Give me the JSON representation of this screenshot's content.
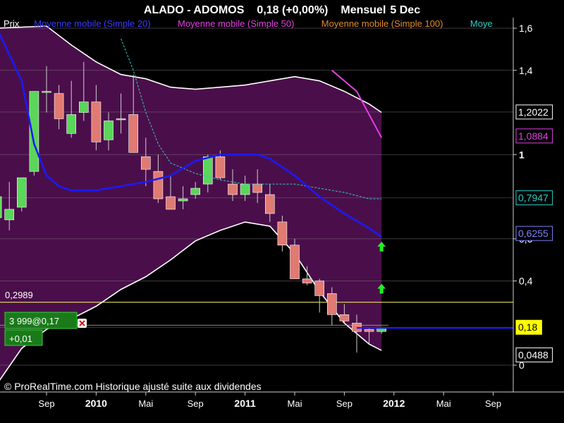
{
  "header": {
    "title": "ALADO - ADOMOS",
    "price_change": "0,18 (+0,00%)",
    "period": "Mensuel",
    "date": "5 Dec"
  },
  "legend": [
    {
      "label": "Prix",
      "color": "#ffffff"
    },
    {
      "label": "Moyenne mobile (Simple 20)",
      "color": "#3a3aff"
    },
    {
      "label": "Moyenne mobile (Simple 50)",
      "color": "#e040e0"
    },
    {
      "label": "Moyenne mobile (Simple 100)",
      "color": "#e08a2a"
    },
    {
      "label": "Moye",
      "color": "#2ad0c8"
    }
  ],
  "order_box": {
    "line1": "3 999@0,17",
    "line2": "+0,01"
  },
  "level_label": "0,2989",
  "footer": "© ProRealTime.com Historique ajusté suite aux dividendes",
  "colors": {
    "background": "#000000",
    "band_fill": "#4a0f4a",
    "bull": "#5ad65a",
    "bear": "#e07a72",
    "ma20": "#1a1aff",
    "ma50": "#e040e0",
    "ma100": "#e08a2a",
    "ma_cyan": "#2ad0c8",
    "bands": "#ffffff",
    "level": "#ffff66",
    "arrow": "#22ee22"
  },
  "chart_data": {
    "type": "candlestick",
    "y_scale": "linear",
    "ylim": [
      -0.09,
      1.65
    ],
    "grid": true,
    "y_ticks": [
      "1,6",
      "1,4",
      "1",
      "0,6",
      "0,4",
      "0"
    ],
    "y_tick_values": [
      1.6,
      1.4,
      1.0,
      0.6,
      0.4,
      0.0
    ],
    "x_ticks": [
      {
        "label": "Sep",
        "bold": false
      },
      {
        "label": "2010",
        "bold": true
      },
      {
        "label": "Mai",
        "bold": false
      },
      {
        "label": "Sep",
        "bold": false
      },
      {
        "label": "2011",
        "bold": true
      },
      {
        "label": "Mai",
        "bold": false
      },
      {
        "label": "Sep",
        "bold": false
      },
      {
        "label": "2012",
        "bold": true
      },
      {
        "label": "Mai",
        "bold": false
      },
      {
        "label": "Sep",
        "bold": false
      }
    ],
    "x_tick_index": [
      4,
      8,
      12,
      16,
      20,
      24,
      28,
      32,
      36,
      40
    ],
    "price_tags": [
      {
        "label": "1,2022",
        "value": 1.2022,
        "fg": "#ffffff",
        "bg": "#000000",
        "border": "#ffffff"
      },
      {
        "label": "1,0884",
        "value": 1.0884,
        "fg": "#e040e0",
        "bg": "#000000",
        "border": "#e040e0"
      },
      {
        "label": "0,7947",
        "value": 0.7947,
        "fg": "#2ad0c8",
        "bg": "#000000",
        "border": "#2ad0c8"
      },
      {
        "label": "0,6255",
        "value": 0.6255,
        "fg": "#8080ff",
        "bg": "#000000",
        "border": "#8080ff"
      },
      {
        "label": "0,18",
        "value": 0.18,
        "fg": "#000000",
        "bg": "#ffff00",
        "border": "#ffff00"
      },
      {
        "label": "0,0488",
        "value": 0.0488,
        "fg": "#ffffff",
        "bg": "#000000",
        "border": "#ffffff"
      }
    ],
    "level": 0.2989,
    "last_price": 0.18,
    "candles": [
      {
        "i": 0,
        "o": 0.7,
        "h": 0.88,
        "l": 0.68,
        "c": 0.8
      },
      {
        "i": 1,
        "o": 0.69,
        "h": 0.87,
        "l": 0.64,
        "c": 0.74
      },
      {
        "i": 2,
        "o": 0.75,
        "h": 0.85,
        "l": 0.73,
        "c": 0.89
      },
      {
        "i": 3,
        "o": 0.92,
        "h": 1.08,
        "l": 0.9,
        "c": 1.3
      },
      {
        "i": 4,
        "o": 1.3,
        "h": 1.42,
        "l": 1.2,
        "c": 1.3
      },
      {
        "i": 5,
        "o": 1.29,
        "h": 1.33,
        "l": 1.12,
        "c": 1.17
      },
      {
        "i": 6,
        "o": 1.1,
        "h": 1.35,
        "l": 1.08,
        "c": 1.19
      },
      {
        "i": 7,
        "o": 1.2,
        "h": 1.44,
        "l": 1.16,
        "c": 1.25
      },
      {
        "i": 8,
        "o": 1.25,
        "h": 1.33,
        "l": 1.02,
        "c": 1.06
      },
      {
        "i": 9,
        "o": 1.07,
        "h": 1.2,
        "l": 1.02,
        "c": 1.16
      },
      {
        "i": 10,
        "o": 1.17,
        "h": 1.29,
        "l": 1.1,
        "c": 1.17
      },
      {
        "i": 11,
        "o": 1.19,
        "h": 1.38,
        "l": 1.05,
        "c": 1.01
      },
      {
        "i": 12,
        "o": 0.99,
        "h": 1.08,
        "l": 0.85,
        "c": 0.93
      },
      {
        "i": 13,
        "o": 0.92,
        "h": 1.0,
        "l": 0.77,
        "c": 0.79
      },
      {
        "i": 14,
        "o": 0.8,
        "h": 0.9,
        "l": 0.74,
        "c": 0.74
      },
      {
        "i": 15,
        "o": 0.78,
        "h": 0.85,
        "l": 0.74,
        "c": 0.79
      },
      {
        "i": 16,
        "o": 0.81,
        "h": 0.87,
        "l": 0.79,
        "c": 0.84
      },
      {
        "i": 17,
        "o": 0.86,
        "h": 1.0,
        "l": 0.82,
        "c": 0.99
      },
      {
        "i": 18,
        "o": 0.99,
        "h": 1.02,
        "l": 0.88,
        "c": 0.89
      },
      {
        "i": 19,
        "o": 0.86,
        "h": 0.93,
        "l": 0.78,
        "c": 0.81
      },
      {
        "i": 20,
        "o": 0.81,
        "h": 0.9,
        "l": 0.78,
        "c": 0.86
      },
      {
        "i": 21,
        "o": 0.86,
        "h": 0.93,
        "l": 0.77,
        "c": 0.82
      },
      {
        "i": 22,
        "o": 0.81,
        "h": 0.86,
        "l": 0.68,
        "c": 0.72
      },
      {
        "i": 23,
        "o": 0.68,
        "h": 0.71,
        "l": 0.54,
        "c": 0.57
      },
      {
        "i": 24,
        "o": 0.57,
        "h": 0.6,
        "l": 0.42,
        "c": 0.41
      },
      {
        "i": 25,
        "o": 0.41,
        "h": 0.47,
        "l": 0.38,
        "c": 0.39
      },
      {
        "i": 26,
        "o": 0.4,
        "h": 0.41,
        "l": 0.25,
        "c": 0.33
      },
      {
        "i": 27,
        "o": 0.34,
        "h": 0.37,
        "l": 0.19,
        "c": 0.24
      },
      {
        "i": 28,
        "o": 0.24,
        "h": 0.29,
        "l": 0.2,
        "c": 0.21
      },
      {
        "i": 29,
        "o": 0.2,
        "h": 0.24,
        "l": 0.06,
        "c": 0.16
      },
      {
        "i": 30,
        "o": 0.17,
        "h": 0.18,
        "l": 0.1,
        "c": 0.16
      },
      {
        "i": 31,
        "o": 0.16,
        "h": 0.18,
        "l": 0.15,
        "c": 0.18
      }
    ],
    "ma20": [
      [
        0,
        1.6
      ],
      [
        2,
        1.35
      ],
      [
        3,
        1.05
      ],
      [
        4,
        0.9
      ],
      [
        5,
        0.85
      ],
      [
        6,
        0.83
      ],
      [
        8,
        0.83
      ],
      [
        10,
        0.85
      ],
      [
        12,
        0.87
      ],
      [
        14,
        0.9
      ],
      [
        16,
        0.97
      ],
      [
        18,
        1.0
      ],
      [
        20,
        1.0
      ],
      [
        21,
        1.0
      ],
      [
        22,
        0.98
      ],
      [
        24,
        0.9
      ],
      [
        26,
        0.8
      ],
      [
        28,
        0.72
      ],
      [
        30,
        0.65
      ],
      [
        31,
        0.61
      ]
    ],
    "ma50": [
      [
        27,
        1.4
      ],
      [
        29,
        1.3
      ],
      [
        31,
        1.08
      ]
    ],
    "ma_cyan": [
      [
        10,
        1.55
      ],
      [
        11,
        1.4
      ],
      [
        12,
        1.2
      ],
      [
        13,
        1.05
      ],
      [
        14,
        0.96
      ],
      [
        16,
        0.91
      ],
      [
        18,
        0.88
      ],
      [
        20,
        0.86
      ],
      [
        22,
        0.86
      ],
      [
        24,
        0.86
      ],
      [
        26,
        0.84
      ],
      [
        28,
        0.82
      ],
      [
        30,
        0.79
      ],
      [
        31,
        0.79
      ]
    ],
    "upper_band": [
      [
        0,
        1.6
      ],
      [
        4,
        1.61
      ],
      [
        6,
        1.52
      ],
      [
        8,
        1.44
      ],
      [
        10,
        1.38
      ],
      [
        12,
        1.36
      ],
      [
        14,
        1.32
      ],
      [
        16,
        1.31
      ],
      [
        18,
        1.32
      ],
      [
        20,
        1.33
      ],
      [
        22,
        1.35
      ],
      [
        24,
        1.37
      ],
      [
        26,
        1.35
      ],
      [
        28,
        1.3
      ],
      [
        30,
        1.24
      ],
      [
        31,
        1.2
      ]
    ],
    "lower_band": [
      [
        0,
        -0.09
      ],
      [
        2,
        0.08
      ],
      [
        4,
        0.17
      ],
      [
        6,
        0.22
      ],
      [
        8,
        0.28
      ],
      [
        10,
        0.36
      ],
      [
        12,
        0.42
      ],
      [
        14,
        0.5
      ],
      [
        16,
        0.59
      ],
      [
        18,
        0.64
      ],
      [
        20,
        0.68
      ],
      [
        22,
        0.66
      ],
      [
        24,
        0.53
      ],
      [
        26,
        0.35
      ],
      [
        28,
        0.2
      ],
      [
        30,
        0.1
      ],
      [
        31,
        0.07
      ]
    ],
    "arrows": [
      {
        "i": 31,
        "value": 0.56
      },
      {
        "i": 31,
        "value": 0.36
      }
    ]
  }
}
